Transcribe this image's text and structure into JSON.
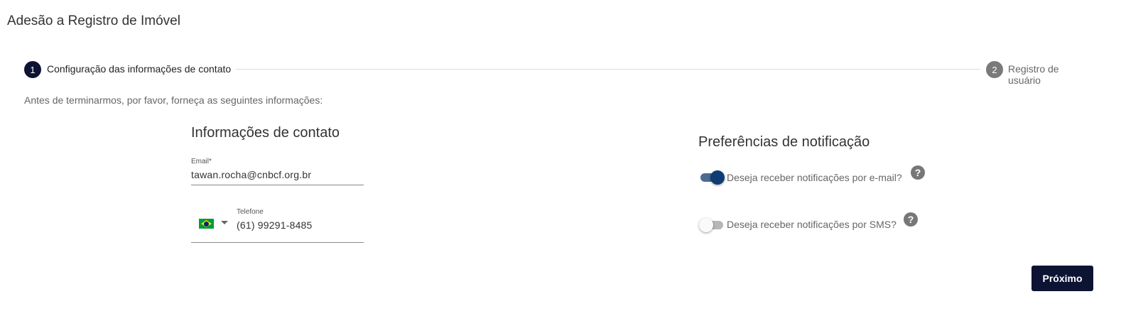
{
  "page": {
    "title": "Adesão a Registro de Imóvel"
  },
  "stepper": {
    "steps": [
      {
        "number": "1",
        "label": "Configuração das informações de contato",
        "state": "active"
      },
      {
        "number": "2",
        "label": "Registro de usuário",
        "state": "inactive"
      }
    ]
  },
  "intro": "Antes de terminarmos, por favor, forneça as seguintes informações:",
  "contact": {
    "title": "Informações de contato",
    "email": {
      "label": "Email*",
      "value": "tawan.rocha@cnbcf.org.br"
    },
    "phone": {
      "label": "Telefone",
      "country_flag": "brazil-flag-icon",
      "value": "(61) 99291-8485"
    }
  },
  "notifications": {
    "title": "Preferências de notificação",
    "email_toggle": {
      "label": "Deseja receber notificações por e-mail?",
      "enabled": true,
      "help_icon": "?"
    },
    "sms_toggle": {
      "label": "Deseja receber notificações por SMS?",
      "enabled": false,
      "help_icon": "?"
    }
  },
  "actions": {
    "next_label": "Próximo"
  },
  "colors": {
    "primary": "#0d1333",
    "toggle_on": "#0d3d73",
    "step_inactive": "#7a7a7a"
  }
}
